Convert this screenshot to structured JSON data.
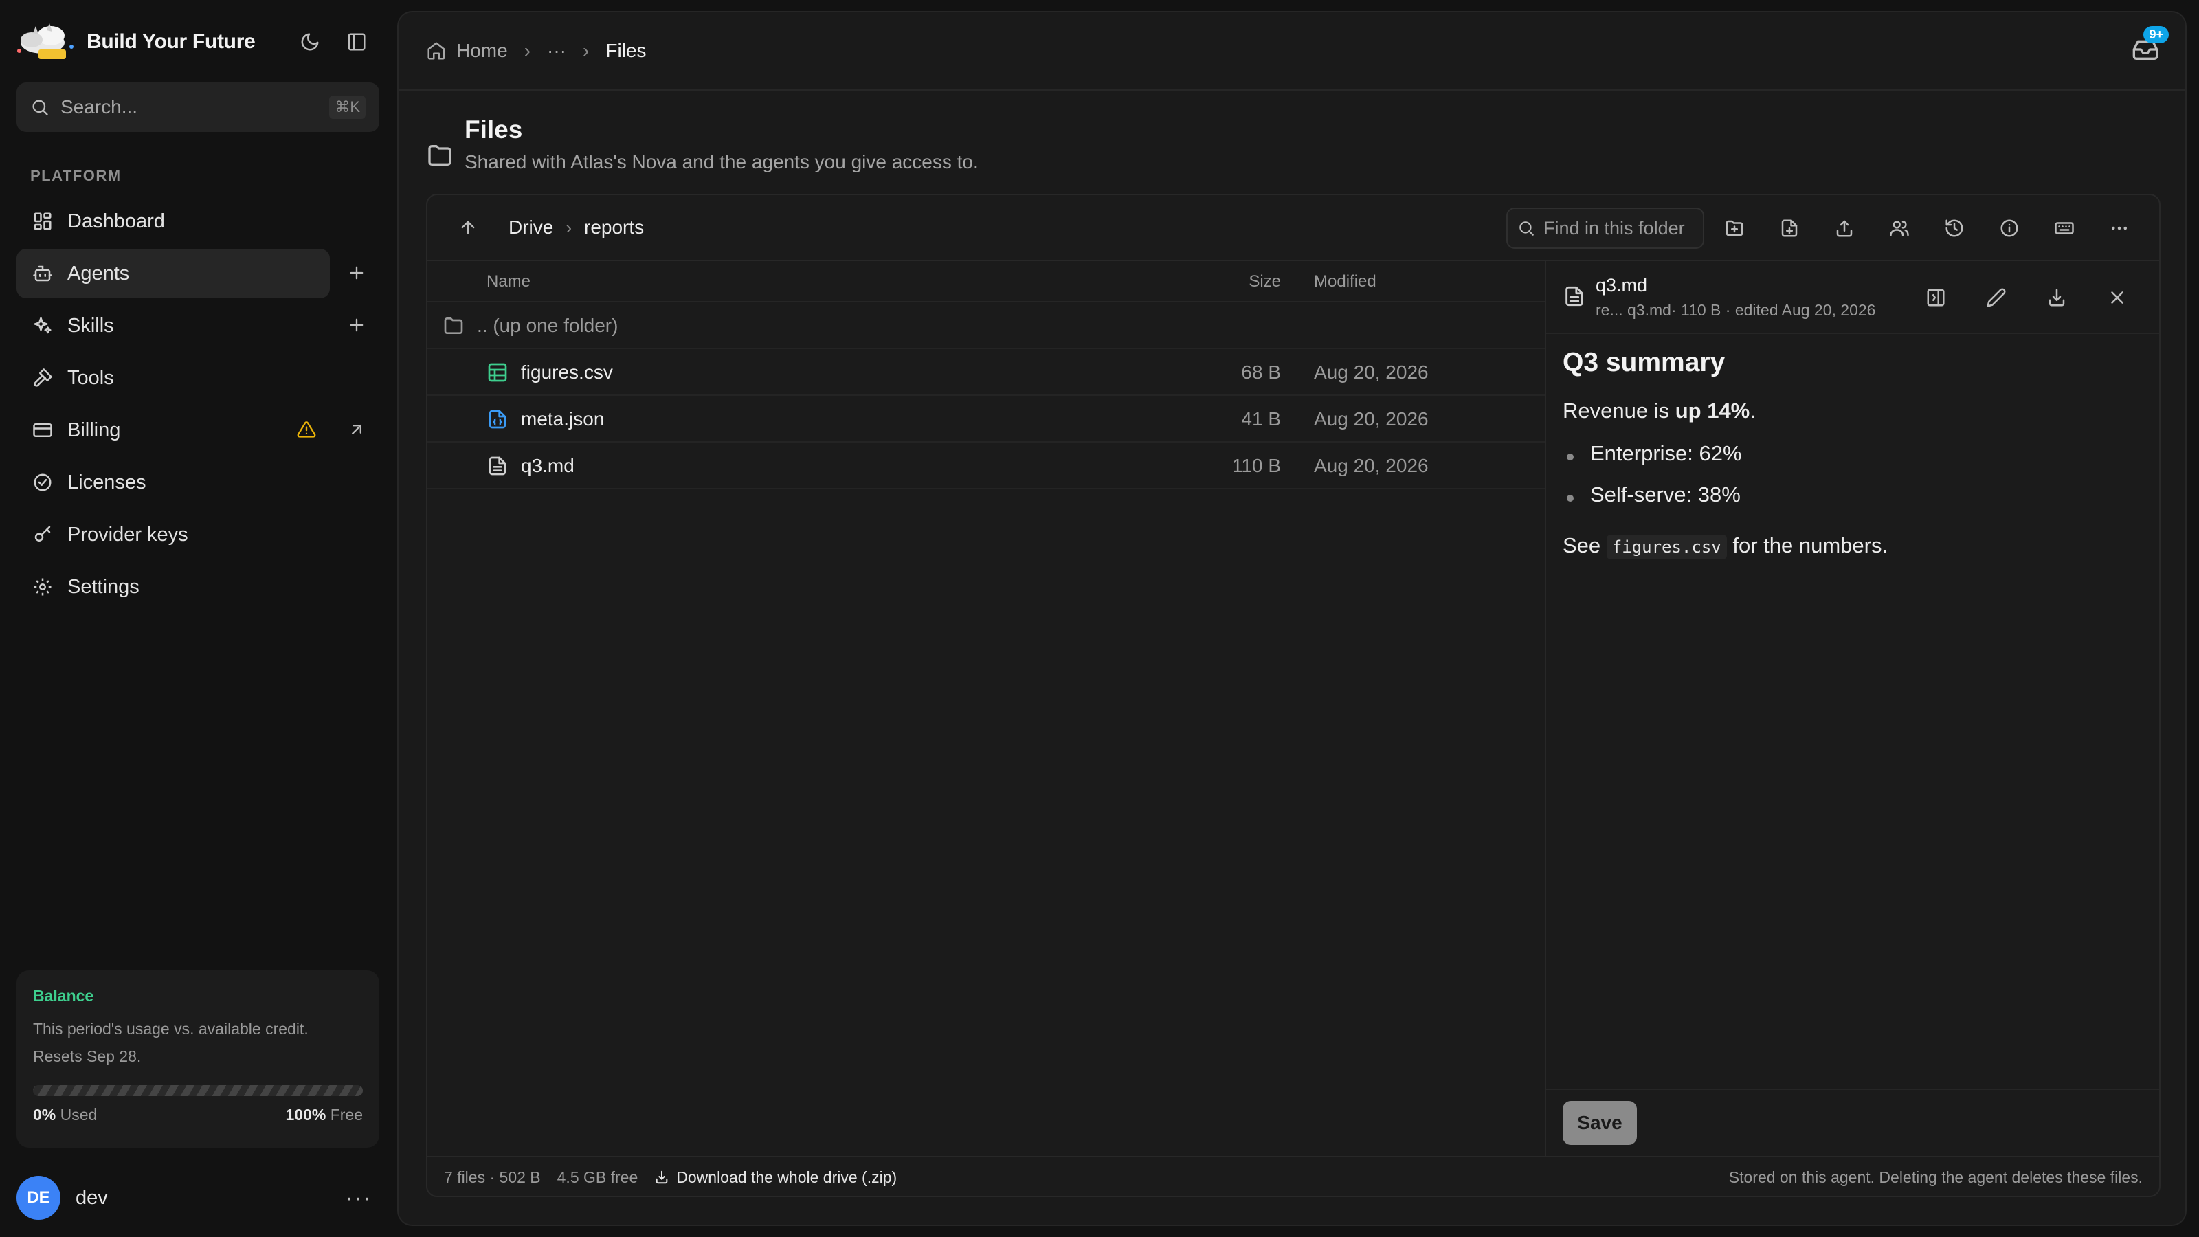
{
  "app": {
    "title": "Build Your Future"
  },
  "search": {
    "placeholder": "Search...",
    "shortcut": "⌘K"
  },
  "sidebar": {
    "section_label": "PLATFORM",
    "items": [
      {
        "label": "Dashboard",
        "icon": "dashboard-icon"
      },
      {
        "label": "Agents",
        "icon": "bot-icon",
        "active": true
      },
      {
        "label": "Skills",
        "icon": "sparkles-icon"
      },
      {
        "label": "Tools",
        "icon": "hammer-icon"
      },
      {
        "label": "Billing",
        "icon": "credit-card-icon"
      },
      {
        "label": "Licenses",
        "icon": "badge-check-icon"
      },
      {
        "label": "Provider keys",
        "icon": "key-icon"
      },
      {
        "label": "Settings",
        "icon": "gear-icon"
      }
    ]
  },
  "balance": {
    "title": "Balance",
    "description": "This period's usage vs. available credit. Resets Sep 28.",
    "used_value": "0%",
    "used_label": "Used",
    "free_value": "100%",
    "free_label": "Free",
    "used_fraction": 0
  },
  "user": {
    "initials": "DE",
    "name": "dev"
  },
  "breadcrumb": {
    "home": "Home",
    "ellipsis": "···",
    "current": "Files"
  },
  "notifications": {
    "badge": "9+"
  },
  "page": {
    "title": "Files",
    "subtitle": "Shared with Atlas's Nova and the agents you give access to."
  },
  "browser": {
    "path": [
      "Drive",
      "reports"
    ],
    "find_placeholder": "Find in this folder",
    "columns": {
      "name": "Name",
      "size": "Size",
      "modified": "Modified"
    },
    "up_row": ".. (up one folder)",
    "files": [
      {
        "name": "figures.csv",
        "size": "68 B",
        "modified": "Aug 20, 2026",
        "icon": "spreadsheet-icon"
      },
      {
        "name": "meta.json",
        "size": "41 B",
        "modified": "Aug 20, 2026",
        "icon": "json-file-icon"
      },
      {
        "name": "q3.md",
        "size": "110 B",
        "modified": "Aug 20, 2026",
        "icon": "text-file-icon"
      }
    ]
  },
  "preview": {
    "file_name": "q3.md",
    "meta": "re... q3.md· 110 B · edited Aug 20, 2026",
    "heading": "Q3 summary",
    "revenue_prefix": "Revenue is ",
    "revenue_bold": "up 14%",
    "revenue_suffix": ".",
    "bullets": [
      "Enterprise: 62%",
      "Self-serve: 38%"
    ],
    "see_prefix": "See ",
    "see_code": "figures.csv",
    "see_suffix": " for the numbers.",
    "save_label": "Save"
  },
  "status": {
    "files_info": "7 files · 502 B",
    "free_info": "4.5 GB free",
    "download_label": "Download the whole drive (.zip)",
    "note": "Stored on this agent. Deleting the agent deletes these files."
  },
  "colors": {
    "accent_green": "#3ecf8e",
    "warning": "#eab308",
    "avatar": "#3b82f6",
    "badge": "#0ea5e9"
  }
}
